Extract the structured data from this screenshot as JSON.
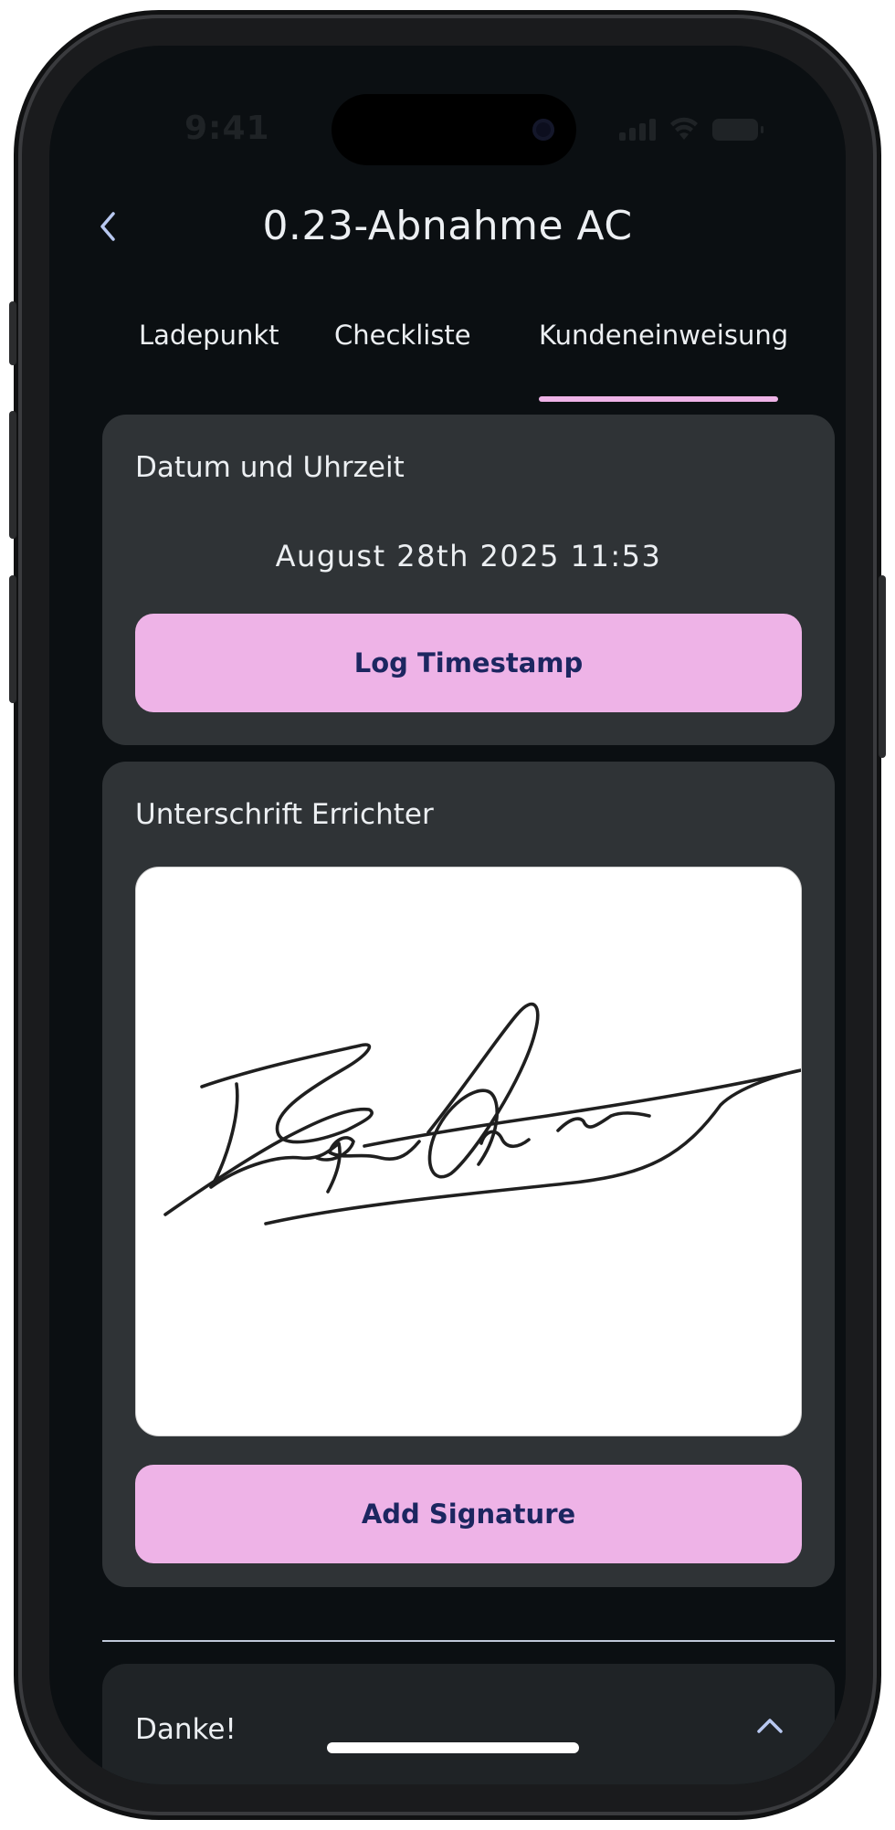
{
  "status_bar": {
    "time": "9:41"
  },
  "header": {
    "title": "0.23-Abnahme AC",
    "back_icon": "chevron-left-icon"
  },
  "tabs": [
    {
      "label": "Ladepunkt"
    },
    {
      "label": "Checkliste"
    },
    {
      "label": "Kundeneinweisung",
      "active": true
    }
  ],
  "datetime_card": {
    "heading": "Datum und Uhrzeit",
    "timestamp": "August 28th 2025 11:53",
    "button_label": "Log Timestamp"
  },
  "signature_card": {
    "heading": "Unterschrift Errichter",
    "button_label": "Add Signature"
  },
  "accordion": {
    "label": "Danke!",
    "icon": "chevron-up-icon"
  },
  "colors": {
    "accent": "#eeb3e7",
    "button_text": "#1c2660",
    "background": "#0b0f12",
    "card": "#2f3336",
    "back_icon": "#b8c8f0"
  }
}
